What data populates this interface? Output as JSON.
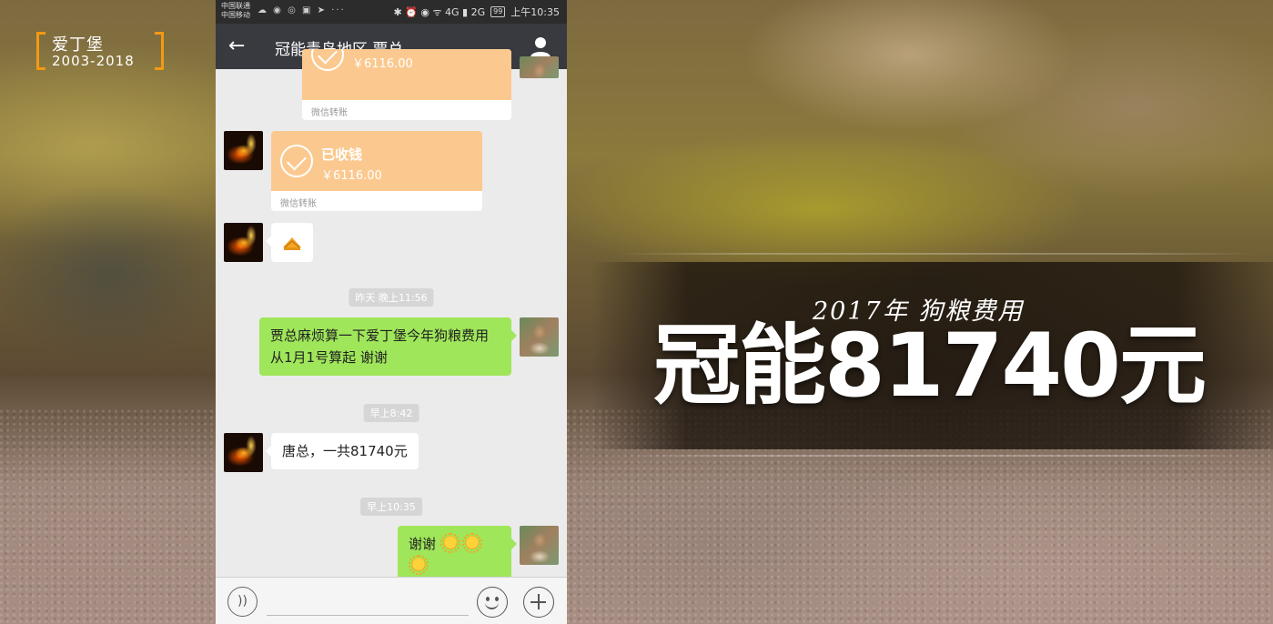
{
  "logo": {
    "name": "爱丁堡",
    "years": "2003-2018",
    "accent_color": "#f39a12"
  },
  "banner": {
    "subtitle": "2017年 狗粮费用",
    "headline": "冠能81740元"
  },
  "phone": {
    "status_bar": {
      "carrier_1": "中国联通",
      "carrier_2": "中国移动",
      "left_icons": "☁ ◉ ◎ ▣ ➤ ···",
      "right_icons": "✱ ⏰ ◉ ᯤ 4G ▮ 2G",
      "battery": "99",
      "time": "上午10:35"
    },
    "title_bar": {
      "back_icon": "back-arrow-icon",
      "title": "冠能青岛地区 贾总",
      "profile_icon": "profile-icon"
    },
    "messages": {
      "transfer_1": {
        "amount": "￥6116.00",
        "footer": "微信转账"
      },
      "transfer_2": {
        "status": "已收钱",
        "amount": "￥6116.00",
        "footer": "微信转账"
      },
      "gift_emoji": "gift-emoji-icon",
      "timestamp_1": "昨天 晚上11:56",
      "msg_right_1": "贾总麻烦算一下爱丁堡今年狗粮费用从1月1号算起 谢谢",
      "timestamp_2": "早上8:42",
      "msg_left_1": "唐总，一共81740元",
      "timestamp_3": "早上10:35",
      "msg_right_2": "谢谢"
    },
    "input_bar": {
      "voice_icon": "voice-icon",
      "emoji_icon": "emoji-icon",
      "plus_icon": "plus-icon"
    },
    "colors": {
      "title_bar": "#393a3f",
      "bubble_sent": "#9fe65a",
      "transfer": "#fbc98f"
    }
  }
}
